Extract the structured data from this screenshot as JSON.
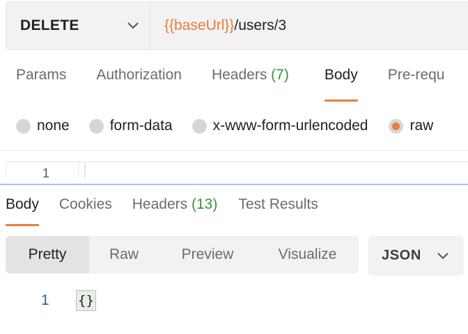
{
  "request": {
    "method": "DELETE",
    "url_variable": "{{baseUrl}}",
    "url_path": "/users/3"
  },
  "request_tabs": [
    {
      "label": "Params",
      "count": ""
    },
    {
      "label": "Authorization",
      "count": ""
    },
    {
      "label": "Headers",
      "count": "(7)"
    },
    {
      "label": "Body",
      "count": "",
      "active": true
    },
    {
      "label": "Pre-requ",
      "count": ""
    }
  ],
  "body_types": [
    {
      "label": "none",
      "checked": false
    },
    {
      "label": "form-data",
      "checked": false
    },
    {
      "label": "x-www-form-urlencoded",
      "checked": false
    },
    {
      "label": "raw",
      "checked": true
    }
  ],
  "editor": {
    "line_number": "1"
  },
  "response_tabs": [
    {
      "label": "Body",
      "count": "",
      "active": true
    },
    {
      "label": "Cookies",
      "count": ""
    },
    {
      "label": "Headers",
      "count": "(13)"
    },
    {
      "label": "Test Results",
      "count": ""
    }
  ],
  "view_modes": [
    {
      "label": "Pretty",
      "active": true
    },
    {
      "label": "Raw"
    },
    {
      "label": "Preview"
    },
    {
      "label": "Visualize"
    }
  ],
  "format": {
    "label": "JSON"
  },
  "response_body": {
    "line_number": "1",
    "content": "{}"
  },
  "colors": {
    "accent": "#e97c3c",
    "count_green": "#3b8f3b",
    "split_blue": "#a9c6e3"
  }
}
